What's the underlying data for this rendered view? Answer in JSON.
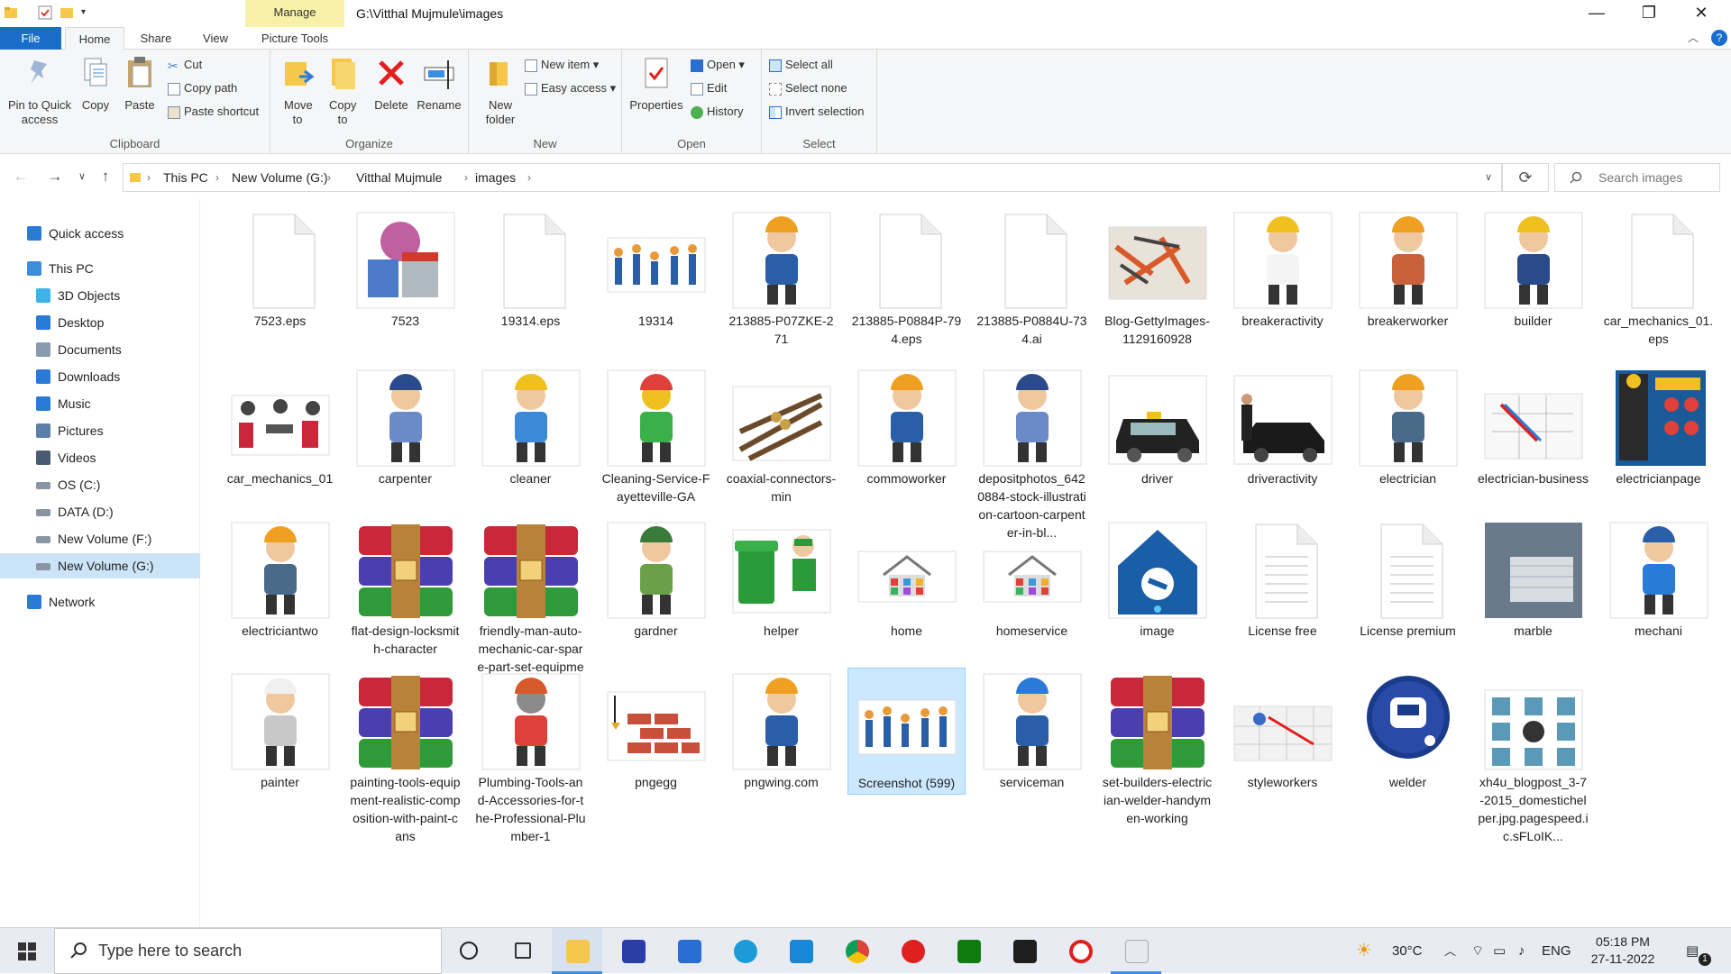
{
  "titlebar": {
    "manage_label": "Manage",
    "path": "G:\\Vitthal Mujmule\\images",
    "minimize": "—",
    "maximize": "❐",
    "close": "✕"
  },
  "tabs": [
    {
      "label": "File"
    },
    {
      "label": "Home"
    },
    {
      "label": "Share"
    },
    {
      "label": "View"
    },
    {
      "label": "Picture Tools"
    }
  ],
  "ribbon": {
    "clipboard": {
      "group": "Clipboard",
      "pin": "Pin to Quick access",
      "copy": "Copy",
      "paste": "Paste",
      "cut": "Cut",
      "copy_path": "Copy path",
      "paste_shortcut": "Paste shortcut"
    },
    "organize": {
      "group": "Organize",
      "move_to": "Move to",
      "copy_to": "Copy to",
      "delete": "Delete",
      "rename": "Rename"
    },
    "new": {
      "group": "New",
      "new_folder": "New folder",
      "new_item": "New item",
      "easy_access": "Easy access"
    },
    "open": {
      "group": "Open",
      "properties": "Properties",
      "open": "Open",
      "edit": "Edit",
      "history": "History"
    },
    "select": {
      "group": "Select",
      "select_all": "Select all",
      "select_none": "Select none",
      "invert": "Invert selection"
    }
  },
  "address": {
    "crumbs": [
      "This PC",
      "New Volume (G:)",
      "Vitthal Mujmule",
      "images"
    ],
    "search_placeholder": "Search images"
  },
  "sidebar": {
    "items": [
      {
        "label": "Quick access",
        "icon": "star-icon"
      },
      {
        "label": "This PC",
        "icon": "pc-icon"
      },
      {
        "label": "3D Objects",
        "icon": "cube-icon"
      },
      {
        "label": "Desktop",
        "icon": "desktop-icon"
      },
      {
        "label": "Documents",
        "icon": "documents-icon"
      },
      {
        "label": "Downloads",
        "icon": "download-icon"
      },
      {
        "label": "Music",
        "icon": "music-icon"
      },
      {
        "label": "Pictures",
        "icon": "pictures-icon"
      },
      {
        "label": "Videos",
        "icon": "videos-icon"
      },
      {
        "label": "OS (C:)",
        "icon": "drive-icon"
      },
      {
        "label": "DATA (D:)",
        "icon": "drive-icon"
      },
      {
        "label": "New Volume (F:)",
        "icon": "drive-icon"
      },
      {
        "label": "New Volume (G:)",
        "icon": "drive-icon",
        "selected": true
      },
      {
        "label": "Network",
        "icon": "network-icon"
      }
    ]
  },
  "files": [
    {
      "name": "7523.eps",
      "icon": "blank-file-icon"
    },
    {
      "name": "7523",
      "icon": "paint-cans-icon"
    },
    {
      "name": "19314.eps",
      "icon": "blank-file-icon"
    },
    {
      "name": "19314",
      "icon": "workers-group-icon"
    },
    {
      "name": "213885-P07ZKE-271",
      "icon": "worker-icon"
    },
    {
      "name": "213885-P0884P-794.eps",
      "icon": "blank-file-icon"
    },
    {
      "name": "213885-P0884U-734.ai",
      "icon": "blank-file-icon"
    },
    {
      "name": "Blog-GettyImages-1129160928",
      "icon": "tools-photo-icon"
    },
    {
      "name": "breakeractivity",
      "icon": "breaker-icon"
    },
    {
      "name": "breakerworker",
      "icon": "breaker-worker-icon"
    },
    {
      "name": "builder",
      "icon": "builder-icon"
    },
    {
      "name": "car_mechanics_01.eps",
      "icon": "blank-file-icon"
    },
    {
      "name": "car_mechanics_01",
      "icon": "mechanics-icon"
    },
    {
      "name": "carpenter",
      "icon": "carpenter-icon"
    },
    {
      "name": "cleaner",
      "icon": "cleaner-icon"
    },
    {
      "name": "Cleaning-Service-Fayetteville-GA",
      "icon": "cleaning-service-icon"
    },
    {
      "name": "coaxial-connectors-min",
      "icon": "connectors-icon"
    },
    {
      "name": "commoworker",
      "icon": "worker-icon"
    },
    {
      "name": "depositphotos_6420884-stock-illustration-cartoon-carpenter-in-bl...",
      "icon": "carpenter-icon"
    },
    {
      "name": "driver",
      "icon": "taxi-icon"
    },
    {
      "name": "driveractivity",
      "icon": "car-icon"
    },
    {
      "name": "electrician",
      "icon": "electrician-icon"
    },
    {
      "name": "electrician-business",
      "icon": "wiring-icon"
    },
    {
      "name": "electricianpage",
      "icon": "electrician-poster-icon"
    },
    {
      "name": "electriciantwo",
      "icon": "electrician-icon"
    },
    {
      "name": "flat-design-locksmith-character",
      "icon": "winrar-icon"
    },
    {
      "name": "friendly-man-auto-mechanic-car-spare-part-set-equipment-access...",
      "icon": "winrar-icon"
    },
    {
      "name": "gardner",
      "icon": "gardener-icon"
    },
    {
      "name": "helper",
      "icon": "trash-helper-icon"
    },
    {
      "name": "home",
      "icon": "home-service-icon"
    },
    {
      "name": "homeservice",
      "icon": "home-service-icon"
    },
    {
      "name": "image",
      "icon": "plumbing-logo-icon"
    },
    {
      "name": "License free",
      "icon": "text-file-icon"
    },
    {
      "name": "License premium",
      "icon": "text-file-icon"
    },
    {
      "name": "marble",
      "icon": "marble-photo-icon"
    },
    {
      "name": "mechani",
      "icon": "mechanic-icon"
    },
    {
      "name": "painter",
      "icon": "painter-icon"
    },
    {
      "name": "painting-tools-equipment-realistic-composition-with-paint-cans",
      "icon": "winrar-icon"
    },
    {
      "name": "Plumbing-Tools-and-Accessories-for-the-Professional-Plumber-1",
      "icon": "plumbing-tools-icon"
    },
    {
      "name": "pngegg",
      "icon": "bricks-icon"
    },
    {
      "name": "pngwing.com",
      "icon": "worker-icon"
    },
    {
      "name": "Screenshot (599)",
      "icon": "workers-group-icon",
      "selected": true
    },
    {
      "name": "serviceman",
      "icon": "serviceman-icon"
    },
    {
      "name": "set-builders-electrician-welder-handymen-working",
      "icon": "winrar-icon"
    },
    {
      "name": "styleworkers",
      "icon": "tiles-icon"
    },
    {
      "name": "welder",
      "icon": "welder-icon"
    },
    {
      "name": "xh4u_blogpost_3-7-2015_domestichelper.jpg.pagespeed.ic.sFLoIK...",
      "icon": "helpers-grid-icon"
    }
  ],
  "taskbar": {
    "search_placeholder": "Type here to search",
    "weather": "30°C",
    "language": "ENG",
    "time": "05:18 PM",
    "date": "27-11-2022",
    "notifications": "1"
  }
}
